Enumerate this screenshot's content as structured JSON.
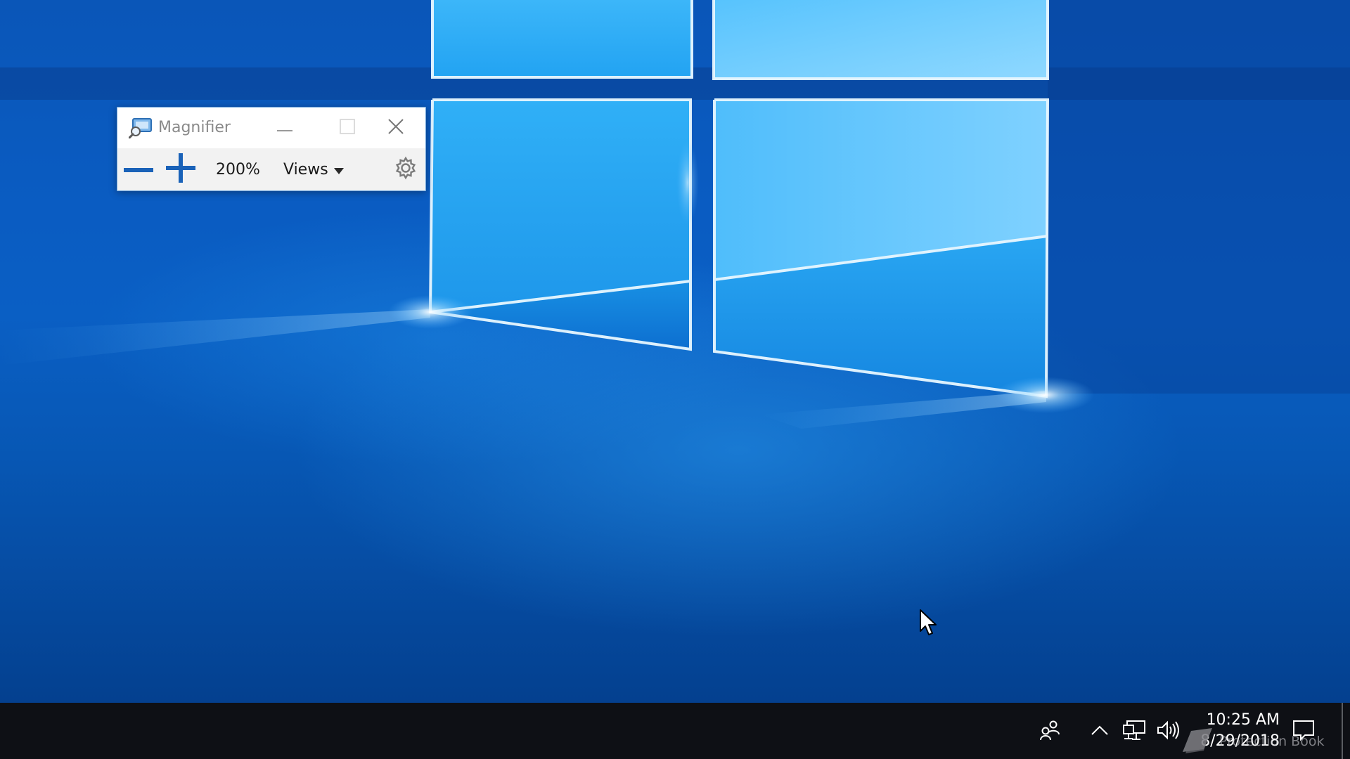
{
  "desktop": {
    "wallpaper": "windows-10-hero-wallpaper",
    "colors": {
      "pane_light": "#6ccaff",
      "pane_mid": "#3fb0f7",
      "frame_dark": "#073f92"
    }
  },
  "magnifier": {
    "title": "Magnifier",
    "zoom_level": "200%",
    "views_label": "Views",
    "icons": {
      "app": "magnifier-app-icon",
      "minimize": "minimize-icon",
      "maximize": "maximize-icon",
      "close": "close-icon",
      "zoom_out": "minus-icon",
      "zoom_in": "plus-icon",
      "views_dropdown": "caret-down-icon",
      "settings": "gear-icon"
    },
    "colors": {
      "accent": "#1a62b8",
      "title_text": "#8a8a8a",
      "toolbar_bg": "#f2f2f2"
    }
  },
  "taskbar": {
    "clock": {
      "time": "10:25 AM",
      "date": "8/29/2018"
    },
    "watermark": "Protection Book",
    "icons": {
      "people": "people-icon",
      "hidden_icons": "chevron-up-icon",
      "network": "network-icon",
      "volume": "volume-icon",
      "notifications": "notification-icon"
    },
    "colors": {
      "background": "#0e1015",
      "text": "#ffffff"
    }
  }
}
